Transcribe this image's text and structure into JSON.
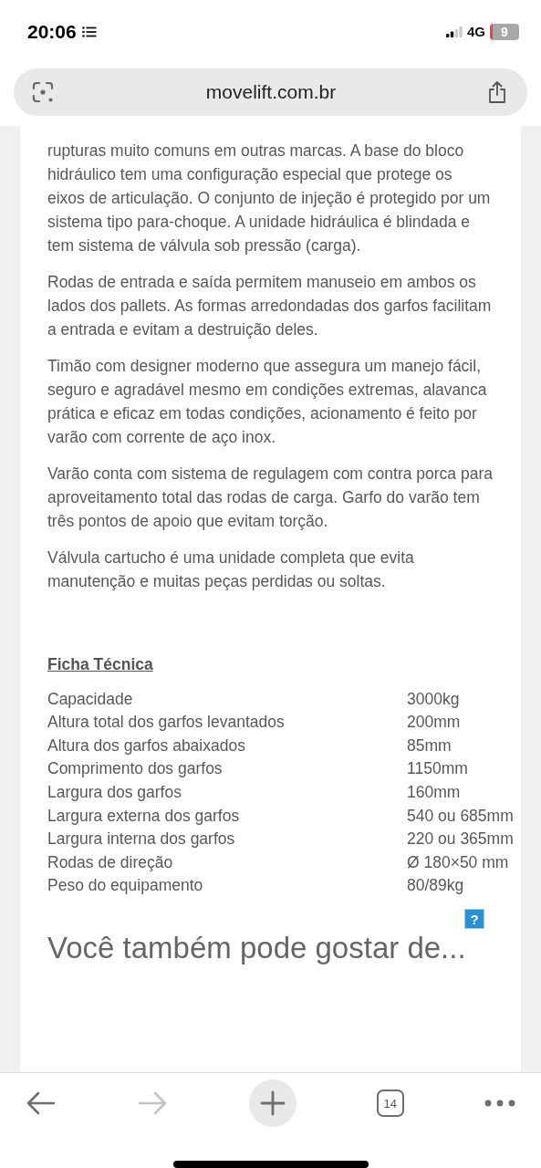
{
  "status_bar": {
    "time": "20:06",
    "network": "4G",
    "battery": "9"
  },
  "address_bar": {
    "url": "movelift.com.br"
  },
  "paragraphs": [
    "rupturas muito comuns em outras marcas. A base do bloco hidráulico tem uma configuração especial que protege os eixos de articulação. O conjunto de injeção é protegido por um sistema tipo para-choque. A unidade hidráulica é blindada e tem sistema de válvula sob pressão (carga).",
    "Rodas de entrada e saída permitem manuseio em ambos os lados dos pallets. As formas arredondadas dos garfos facilitam a entrada e evitam a destruição deles.",
    "Timão com designer moderno que assegura um manejo fácil, seguro e agradável mesmo em condições extremas, alavanca prática e eficaz em todas condições, acionamento é feito por varão com corrente de aço inox.",
    "Varão conta com sistema de regulagem com contra porca para aproveitamento total das rodas de carga. Garfo do varão tem três pontos de apoio que evitam torção.",
    "Válvula cartucho é uma unidade completa que evita manutenção e muitas peças perdidas ou soltas."
  ],
  "spec_heading": "Ficha Técnica",
  "specs": [
    {
      "label": "Capacidade",
      "value": "3000kg"
    },
    {
      "label": "Altura total dos garfos levantados",
      "value": "200mm"
    },
    {
      "label": "Altura dos garfos abaixados",
      "value": "85mm"
    },
    {
      "label": "Comprimento dos garfos",
      "value": "1150mm"
    },
    {
      "label": "Largura dos garfos",
      "value": "160mm"
    },
    {
      "label": "Largura externa dos garfos",
      "value": "540 ou 685mm"
    },
    {
      "label": "Largura interna dos garfos",
      "value": "220 ou 365mm"
    },
    {
      "label": "Rodas de direção",
      "value": "Ø 180×50 mm"
    },
    {
      "label": "Peso do equipamento",
      "value": "80/89kg"
    }
  ],
  "help_badge": "?",
  "related_heading": "Você também pode gostar de...",
  "toolbar": [
    {
      "kind": "back",
      "disabled": false
    },
    {
      "kind": "forward",
      "disabled": true
    },
    {
      "kind": "new-tab",
      "disabled": false
    },
    {
      "kind": "tabs",
      "label": "14",
      "disabled": false
    },
    {
      "kind": "more",
      "disabled": false
    }
  ]
}
